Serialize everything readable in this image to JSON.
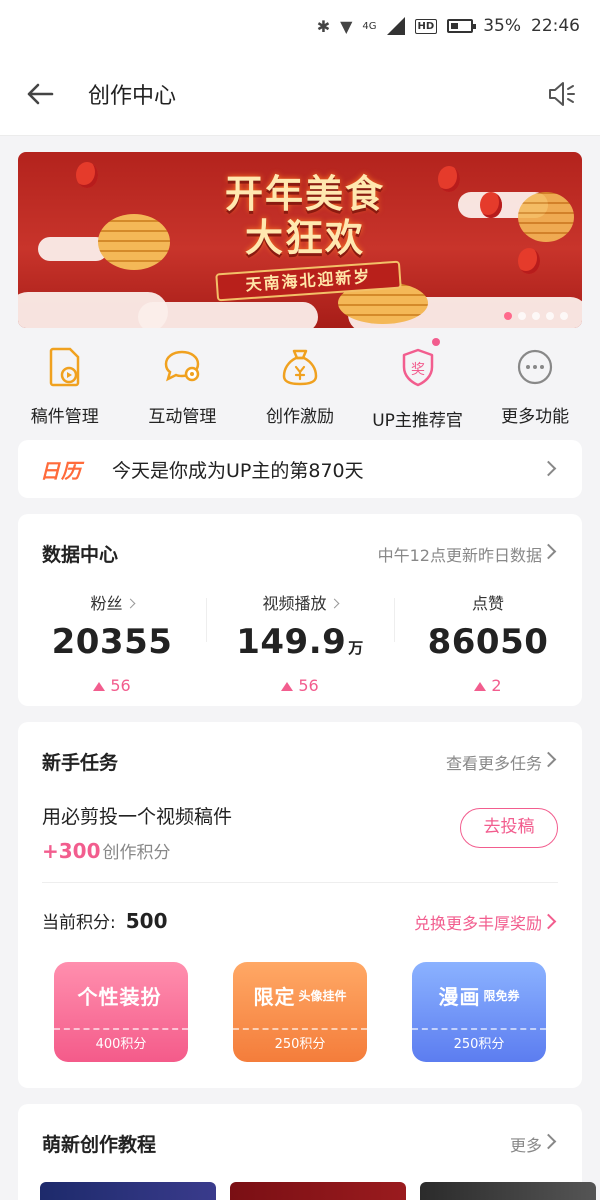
{
  "status_bar": {
    "network": "4G",
    "hd": "HD",
    "battery": "35%",
    "time": "22:46"
  },
  "header": {
    "title": "创作中心"
  },
  "banner": {
    "title_line1": "开年美食",
    "title_line2": "大狂欢",
    "subtitle": "天南海北迎新岁",
    "slide_count": 5,
    "active_slide": 1
  },
  "quick_actions": [
    {
      "label": "稿件管理",
      "icon": "manuscript-icon"
    },
    {
      "label": "互动管理",
      "icon": "comment-icon"
    },
    {
      "label": "创作激励",
      "icon": "money-bag-icon"
    },
    {
      "label": "UP主推荐官",
      "icon": "award-badge-icon"
    },
    {
      "label": "更多功能",
      "icon": "more-icon"
    }
  ],
  "calendar": {
    "badge": "日历",
    "text": "今天是你成为UP主的第870天"
  },
  "data_center": {
    "title": "数据中心",
    "update_note": "中午12点更新昨日数据",
    "stats": [
      {
        "label": "粉丝",
        "value": "20355",
        "unit": "",
        "delta": "56"
      },
      {
        "label": "视频播放",
        "value": "149.9",
        "unit": "万",
        "delta": "56"
      },
      {
        "label": "点赞",
        "value": "86050",
        "unit": "",
        "delta": "2"
      }
    ]
  },
  "tasks": {
    "title": "新手任务",
    "more_link": "查看更多任务",
    "task_name": "用必剪投一个视频稿件",
    "task_points": "+300",
    "task_points_suffix": "创作积分",
    "submit_label": "去投稿",
    "current_points_label": "当前积分:",
    "current_points": "500",
    "rewards_link": "兑换更多丰厚奖励",
    "rewards": [
      {
        "title": "个性装扮",
        "subtitle": "",
        "cost": "400积分"
      },
      {
        "title": "限定",
        "subtitle": "头像挂件",
        "cost": "250积分"
      },
      {
        "title": "漫画",
        "subtitle": "限免券",
        "cost": "250积分"
      }
    ]
  },
  "tutorials": {
    "title": "萌新创作教程",
    "more_link": "更多"
  },
  "colors": {
    "accent": "#f25d8e",
    "calendar_badge": "#ff6b3b",
    "banner_red": "#b3231d"
  }
}
